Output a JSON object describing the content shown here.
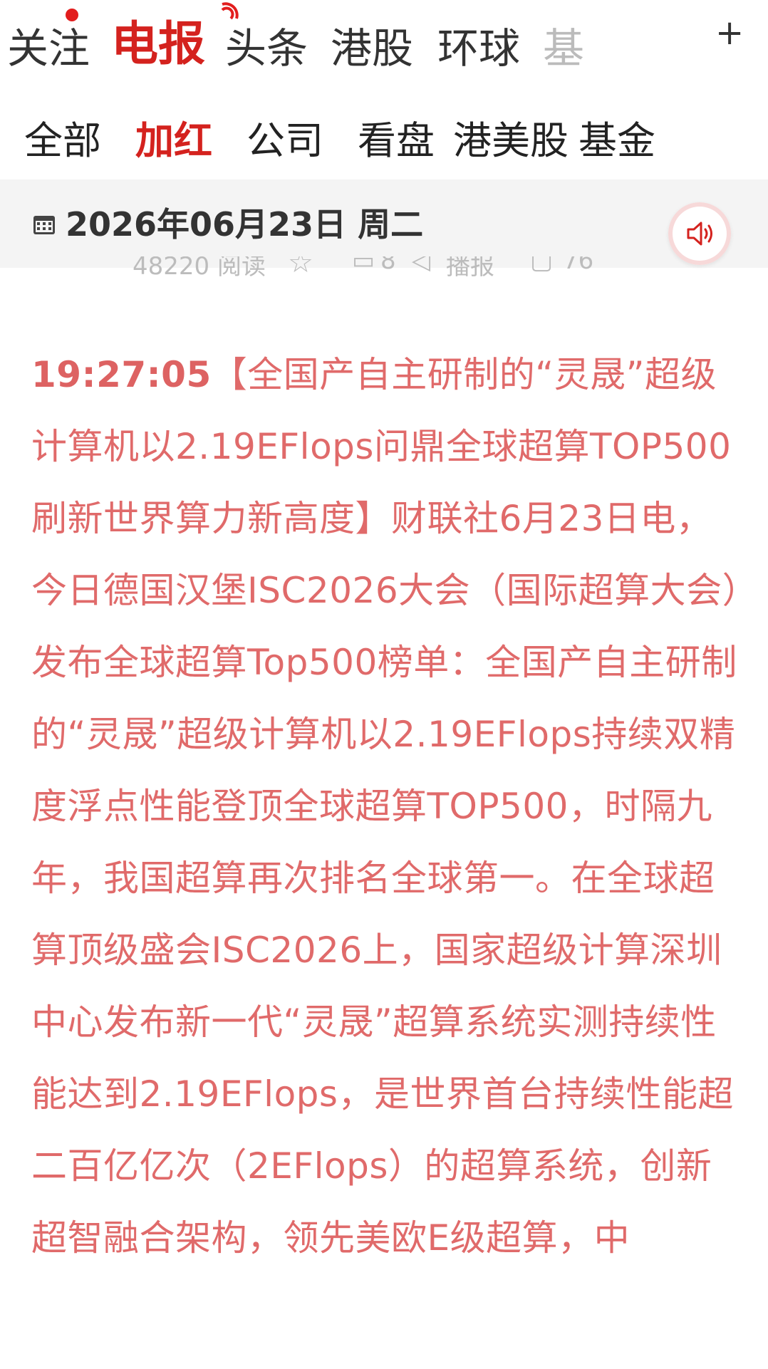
{
  "top_tabs": [
    {
      "label": "关注"
    },
    {
      "label": "电报"
    },
    {
      "label": "头条"
    },
    {
      "label": "港股"
    },
    {
      "label": "环球"
    },
    {
      "label": "基"
    }
  ],
  "plus_symbol": "+",
  "sub_tabs": [
    {
      "label": "全部"
    },
    {
      "label": "加红"
    },
    {
      "label": "公司"
    },
    {
      "label": "看盘"
    },
    {
      "label": "港美股"
    },
    {
      "label": "基金"
    }
  ],
  "date_bar": {
    "date": "2026年06月23日 周二"
  },
  "prev_item_stats": {
    "reads": "48220 阅读",
    "comments": "8",
    "share_label": "播报",
    "likes": "76"
  },
  "article": {
    "time": "19:27:05",
    "title": "【全国产自主研制的“灵晟”超级计算机以2.19EFlops问鼎全球超算TOP500 刷新世界算力新高度】",
    "body": "财联社6月23日电，今日德国汉堡ISC2026大会（国际超算大会）发布全球超算Top500榜单：全国产自主研制的“灵晟”超级计算机以2.19EFlops持续双精度浮点性能登顶全球超算TOP500，时隔九年，我国超算再次排名全球第一。在全球超算顶级盛会ISC2026上，国家超级计算深圳中心发布新一代“灵晟”超算系统实测持续性能达到2.19EFlops，是世界首台持续性能超二百亿亿次（2EFlops）的超算系统，创新超智融合架构，领先美欧E级超算，中"
  },
  "colors": {
    "accent": "#d4221e",
    "article_text": "#e06a6a",
    "date_bar_bg": "#f4f4f4"
  }
}
